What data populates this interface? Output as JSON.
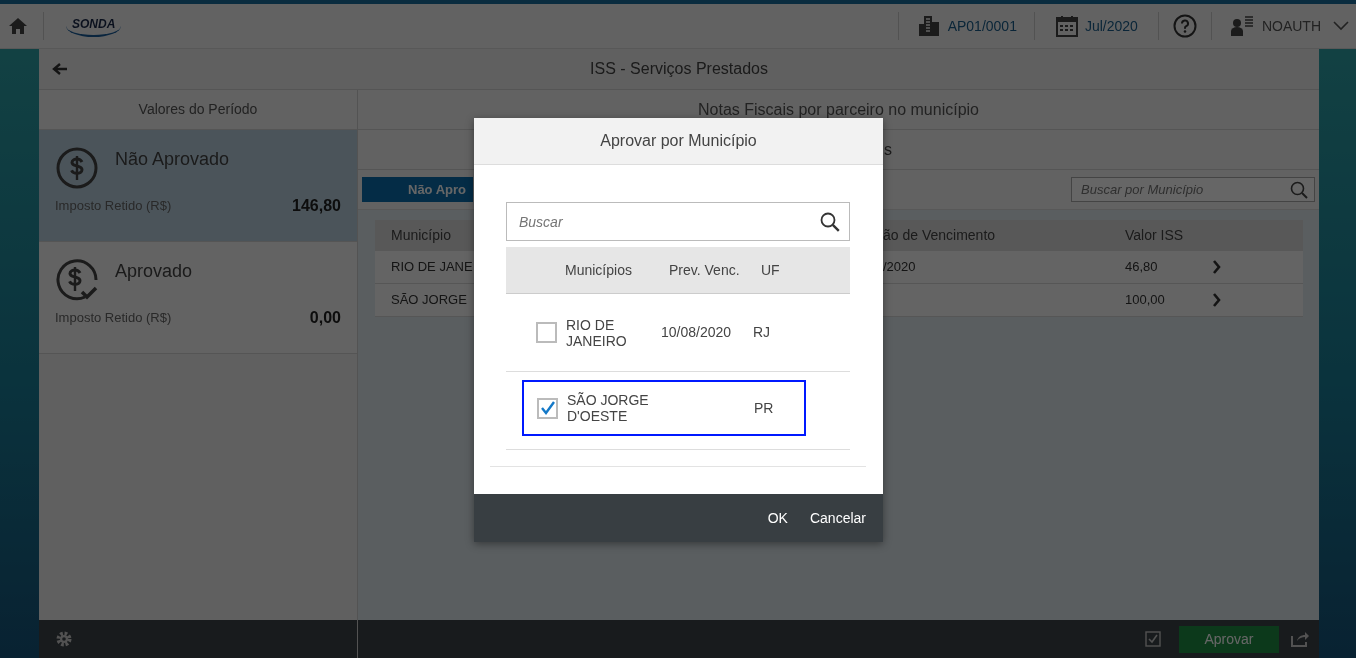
{
  "header": {
    "logo": "SONDA",
    "company": "AP01/0001",
    "period": "Jul/2020",
    "user": "NOAUTH"
  },
  "page": {
    "title": "ISS - Serviços Prestados"
  },
  "summary": {
    "title": "Valores do Período",
    "cards": [
      {
        "kind": "pending",
        "title": "Não Aprovado",
        "label": "Imposto Retido (R$)",
        "value": "146,80",
        "selected": true
      },
      {
        "kind": "approved",
        "title": "Aprovado",
        "label": "Imposto Retido (R$)",
        "value": "0,00",
        "selected": false
      }
    ]
  },
  "notes": {
    "title": "Notas Fiscais por parceiro no município",
    "tabs_text": "s",
    "filter_button": "Não Apro",
    "search": {
      "placeholder": "Buscar por Município"
    },
    "columns": [
      "Município",
      "ão de Vencimento",
      "Valor ISS"
    ],
    "rows": [
      {
        "municipio": "RIO DE JANE",
        "vencimento": "/2020",
        "valor": "46,80"
      },
      {
        "municipio": "SÃO JORGE",
        "valor": "100,00"
      }
    ]
  },
  "footer": {
    "approve_button": "Aprovar"
  },
  "dialog": {
    "title": "Aprovar por Município",
    "search": {
      "placeholder": "Buscar"
    },
    "columns": [
      "Municípios",
      "Prev. Venc.",
      "UF"
    ],
    "rows": [
      {
        "name": "RIO DE JANEIRO",
        "due": "10/08/2020",
        "uf": "RJ",
        "checked": false,
        "focused": false
      },
      {
        "name": "SÃO JORGE D'OESTE",
        "uf": "PR",
        "checked": true,
        "focused": true
      }
    ],
    "buttons": [
      "OK",
      "Cancelar"
    ]
  }
}
